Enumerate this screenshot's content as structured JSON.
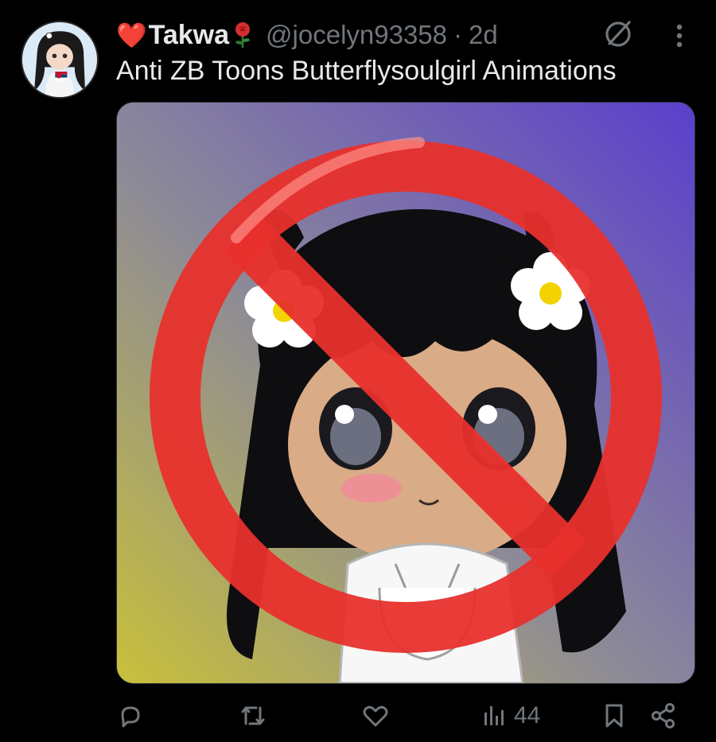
{
  "post": {
    "author": {
      "heart_emoji": "❤️",
      "display_name": "Takwa",
      "rose_icon": "rose-emoji",
      "handle": "@jocelyn93358",
      "separator": "·",
      "time": "2d"
    },
    "text": "Anti ZB Toons Butterflysoulgirl Animations",
    "media": {
      "description_icon": "prohibited-sign-over-chibi-character"
    },
    "actions": {
      "reply_icon": "reply-icon",
      "repost_icon": "repost-icon",
      "like_icon": "heart-icon",
      "views_icon": "views-icon",
      "views_count": "44",
      "bookmark_icon": "bookmark-icon",
      "share_icon": "share-icon"
    },
    "header_icons": {
      "grok": "grok-icon",
      "more": "more-icon"
    }
  },
  "colors": {
    "background": "#000000",
    "text_primary": "#e7e9ea",
    "text_secondary": "#71767b",
    "prohibited_red": "#e8302c"
  }
}
